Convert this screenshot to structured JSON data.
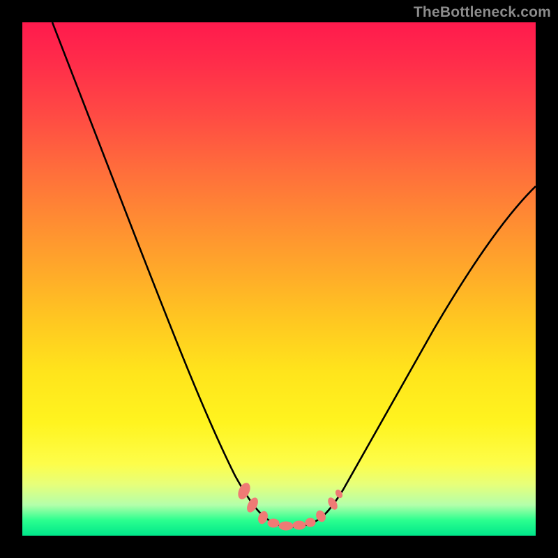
{
  "watermark": "TheBottleneck.com",
  "colors": {
    "background": "#000000",
    "curve_stroke": "#000000",
    "marker_fill": "#ef7a75",
    "marker_stroke": "#c25550"
  },
  "chart_data": {
    "type": "line",
    "title": "",
    "xlabel": "",
    "ylabel": "",
    "xlim": [
      0,
      100
    ],
    "ylim": [
      0,
      100
    ],
    "note": "Values are read off the rendered curve in normalized 0–100 plot coordinates (y = vertical distance from bottom). No axes or labels are present in the image.",
    "series": [
      {
        "name": "curve",
        "x": [
          6,
          10,
          15,
          20,
          25,
          30,
          35,
          40,
          45,
          47,
          50,
          53,
          56,
          58,
          60,
          65,
          70,
          75,
          80,
          85,
          90,
          95,
          100
        ],
        "y": [
          100,
          90,
          78,
          66,
          55,
          43,
          32,
          21,
          11,
          7,
          3,
          1,
          1,
          2,
          4,
          10,
          17,
          25,
          33,
          42,
          50,
          59,
          67
        ]
      }
    ],
    "markers": {
      "name": "floor-marker-band",
      "x": [
        46,
        48,
        50,
        52,
        54,
        56,
        58,
        60
      ],
      "y": [
        5.5,
        3.5,
        2.5,
        2,
        2.5,
        3,
        4,
        6
      ]
    }
  }
}
